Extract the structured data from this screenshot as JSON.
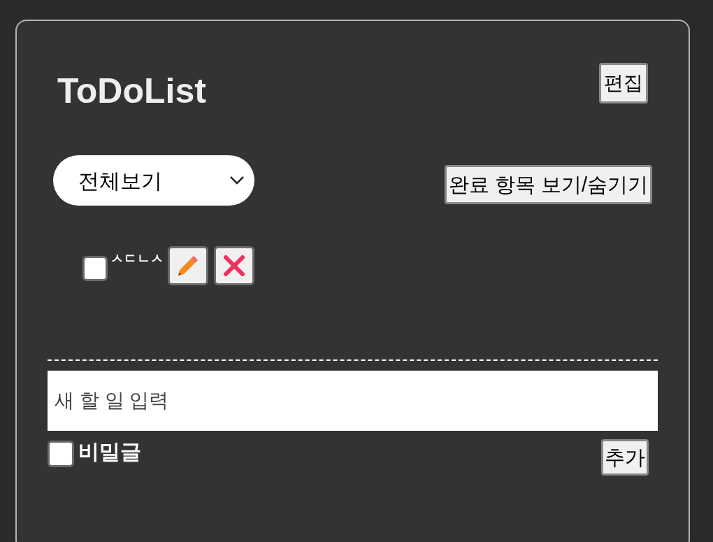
{
  "title": "ToDoList",
  "edit_button": "편집",
  "filter": {
    "value": "전체보기"
  },
  "toggle_completed_button": "완료 항목 보기/숨기기",
  "todos": [
    {
      "text": "ㅅㄷㄴㅅ",
      "checked": false
    }
  ],
  "new_todo": {
    "placeholder": "새 할 일 입력"
  },
  "secret": {
    "label": "비밀글",
    "checked": false
  },
  "add_button": "추가"
}
